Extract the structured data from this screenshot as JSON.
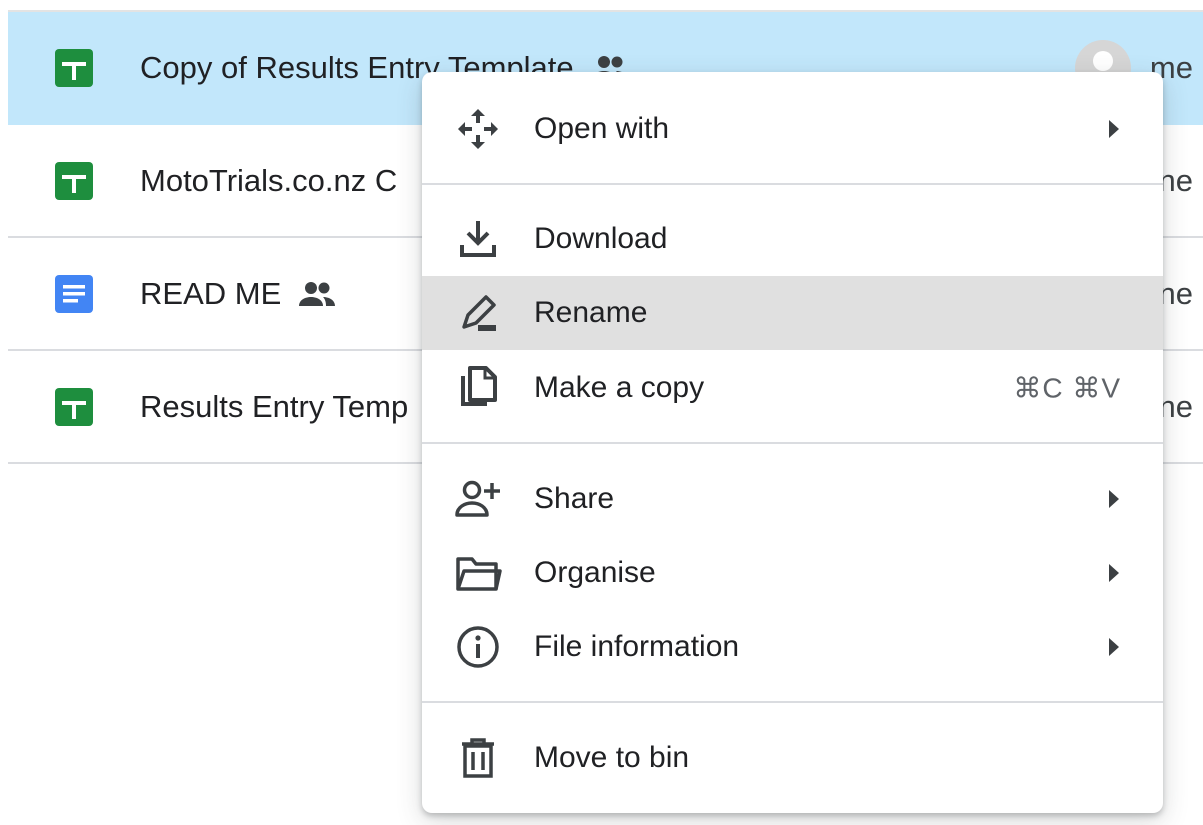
{
  "files": [
    {
      "name": "Copy of Results Entry Template",
      "type": "sheets-icon",
      "shared": true,
      "owner": "me",
      "selected": true
    },
    {
      "name": "MotoTrials.co.nz C",
      "type": "sheets-icon",
      "shared": false,
      "owner": "ne",
      "selected": false
    },
    {
      "name": "READ ME",
      "type": "docs-icon",
      "shared": true,
      "owner": "ne",
      "selected": false
    },
    {
      "name": "Results Entry Temp",
      "type": "sheets-icon",
      "shared": false,
      "owner": "ne",
      "selected": false
    }
  ],
  "context_menu": {
    "open_with": "Open with",
    "download": "Download",
    "rename": "Rename",
    "make_a_copy": "Make a copy",
    "make_a_copy_shortcut": "⌘C ⌘V",
    "share": "Share",
    "organise": "Organise",
    "file_information": "File information",
    "move_to_bin": "Move to bin"
  },
  "colors": {
    "selected_row": "#c2e7fb",
    "hover_item": "#e0e0e0",
    "sheets_green": "#1e8e3e",
    "docs_blue": "#4285f4",
    "icon_grey": "#3c4043"
  }
}
